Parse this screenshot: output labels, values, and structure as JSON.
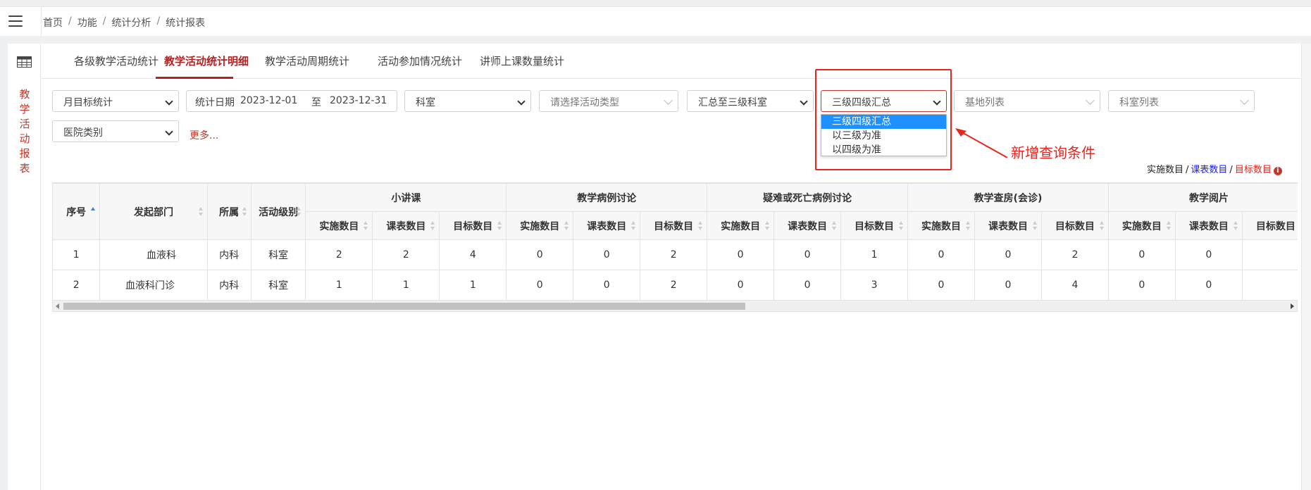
{
  "breadcrumb": [
    "首页",
    "功能",
    "统计分析",
    "统计报表"
  ],
  "sidebar_label": [
    "教",
    "学",
    "活",
    "动",
    "报",
    "表"
  ],
  "tabs": [
    {
      "label": "各级教学活动统计"
    },
    {
      "label": "教学活动统计明细"
    },
    {
      "label": "教学活动周期统计"
    },
    {
      "label": "活动参加情况统计"
    },
    {
      "label": "讲师上课数量统计"
    }
  ],
  "active_tab": 1,
  "filters": {
    "stat_type": "月目标统计",
    "date_label": "统计日期",
    "date_start": "2023-12-01",
    "date_to": "至",
    "date_end": "2023-12-31",
    "dept": "科室",
    "activity_type_placeholder": "请选择活动类型",
    "summary_level": "汇总至三级科室",
    "level_select": "三级四级汇总",
    "base_list_placeholder": "基地列表",
    "dept_list_placeholder": "科室列表",
    "hospital_type": "医院类别",
    "more": "更多..."
  },
  "level_dropdown_options": [
    "三级四级汇总",
    "以三级为准",
    "以四级为准"
  ],
  "annotation": "新增查询条件",
  "legend": {
    "actual": "实施数目",
    "schedule": "课表数目",
    "target": "目标数目",
    "info_icon": "info-icon"
  },
  "colors": {
    "accent": "#b22222",
    "annotation_red": "#e8251f",
    "blue_value": "#1a1aff",
    "red_value": "#e8251f",
    "dropdown_selected": "#1e90ff"
  },
  "table": {
    "fixed_headers": [
      "序号",
      "发起部门",
      "所属",
      "活动级别"
    ],
    "groups": [
      "小讲课",
      "教学病例讨论",
      "疑难或死亡病例讨论",
      "教学查房(会诊)",
      "教学阅片"
    ],
    "sub_headers": [
      "实施数目",
      "课表数目",
      "目标数目"
    ],
    "rows": [
      {
        "no": "1",
        "dept": "血液科",
        "belong": "内科",
        "level": "科室",
        "values": [
          "2",
          "2",
          "4",
          "0",
          "0",
          "2",
          "0",
          "0",
          "1",
          "0",
          "0",
          "2",
          "0",
          "0",
          ""
        ]
      },
      {
        "no": "2",
        "dept": "血液科门诊",
        "belong": "内科",
        "level": "科室",
        "values": [
          "1",
          "1",
          "1",
          "0",
          "0",
          "2",
          "0",
          "0",
          "3",
          "0",
          "0",
          "4",
          "0",
          "0",
          ""
        ]
      }
    ]
  }
}
